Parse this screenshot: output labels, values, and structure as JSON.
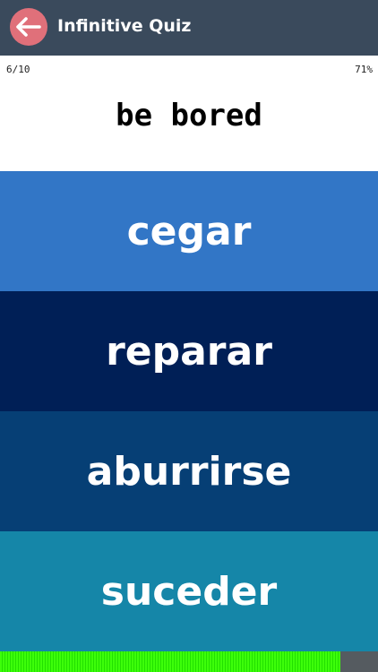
{
  "header": {
    "title": "Infinitive Quiz",
    "back_icon": "arrow-left-icon",
    "back_bg_color": "#e0707a",
    "bg_color": "#3a4a5c"
  },
  "score": {
    "progress_text": "6/10",
    "percent_text": "71%"
  },
  "question": {
    "prompt": "be bored"
  },
  "answers": [
    {
      "label": "cegar",
      "color": "#3276c6"
    },
    {
      "label": "reparar",
      "color": "#001f56"
    },
    {
      "label": "aburrirse",
      "color": "#063f75"
    },
    {
      "label": "suceder",
      "color": "#1586a8"
    }
  ],
  "timer": {
    "fraction_remaining": 0.9,
    "fill_color": "#3dff0a"
  }
}
